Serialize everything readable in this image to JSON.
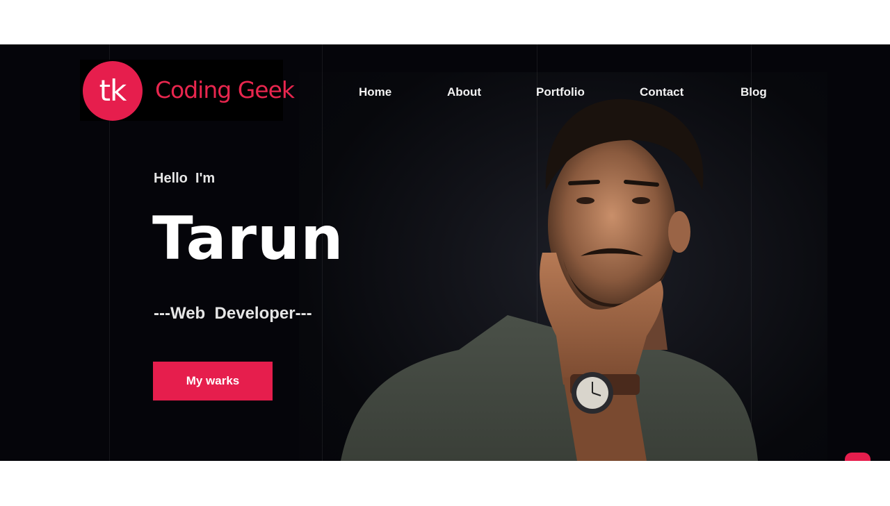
{
  "brand": {
    "monogram": "tk",
    "name": "Coding Geek",
    "accent_color": "#e61e4d"
  },
  "nav": {
    "items": [
      {
        "label": "Home"
      },
      {
        "label": "About"
      },
      {
        "label": "Portfolio"
      },
      {
        "label": "Contact"
      },
      {
        "label": "Blog"
      }
    ]
  },
  "hero": {
    "greeting": "Hello  I'm",
    "name": "Tarun",
    "role": "---Web  Developer---",
    "cta_label": "My warks",
    "background_color": "#05050a"
  },
  "scroll_top": {
    "icon": "chevron-up-icon"
  }
}
